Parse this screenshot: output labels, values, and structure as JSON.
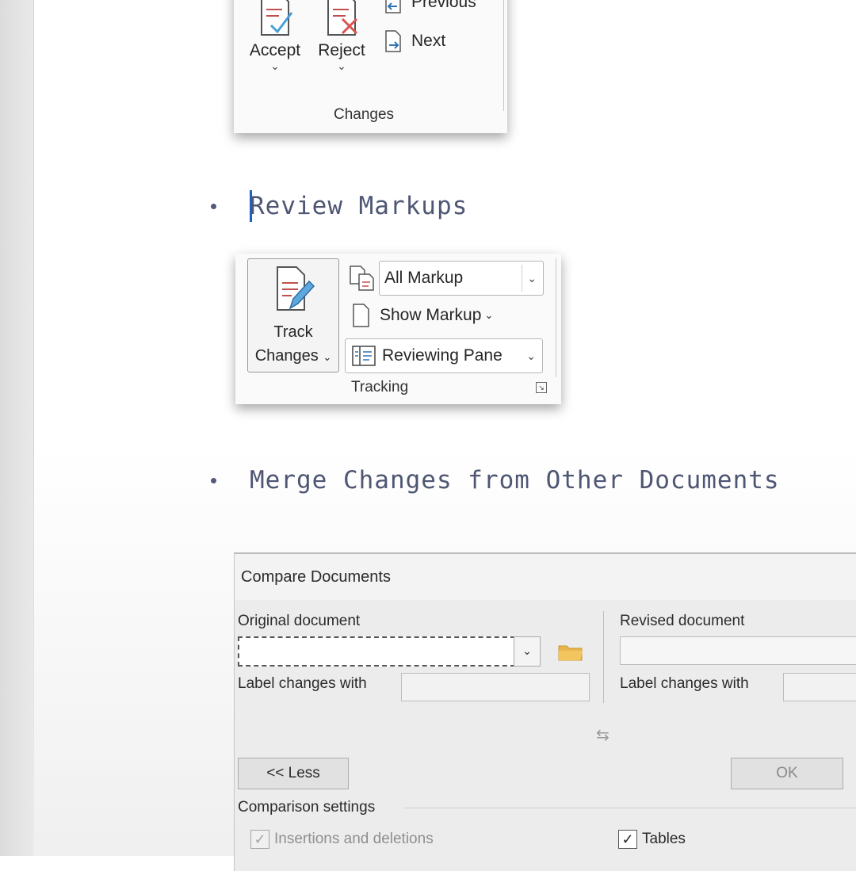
{
  "ribbon_changes": {
    "previous_label": "Previous",
    "next_label": "Next",
    "accept_label": "Accept",
    "reject_label": "Reject",
    "group_label": "Changes"
  },
  "bullets": [
    {
      "text": "Review Markups"
    },
    {
      "text": "Merge Changes from Other Documents"
    }
  ],
  "ribbon_tracking": {
    "track_changes_line1": "Track",
    "track_changes_line2": "Changes",
    "markup_mode": "All Markup",
    "show_markup_label": "Show Markup",
    "reviewing_pane_label": "Reviewing Pane",
    "group_label": "Tracking"
  },
  "compare_dialog": {
    "title": "Compare Documents",
    "original_label": "Original document",
    "revised_label": "Revised document",
    "label_changes_with": "Label changes with",
    "less_button": "<< Less",
    "ok_button": "OK",
    "comparison_settings": "Comparison settings",
    "insertions_deletions": "Insertions and deletions",
    "tables": "Tables"
  },
  "colors": {
    "bullet_text": "#4e5673",
    "accent_blue": "#1f5fbf",
    "reject_red": "#d9534f"
  }
}
